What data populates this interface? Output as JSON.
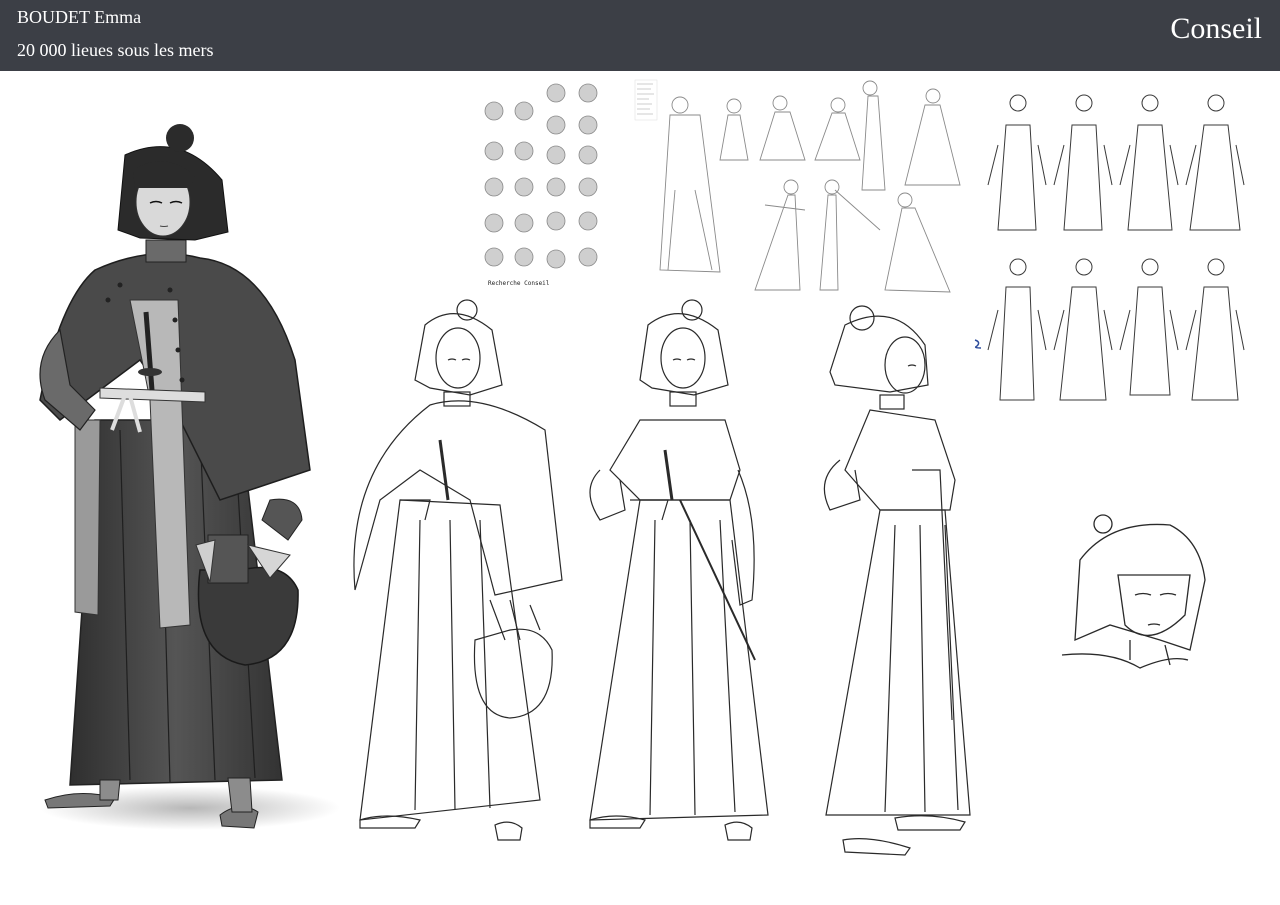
{
  "header": {
    "author": "BOUDET Emma",
    "project": "20 000 lieues sous les mers",
    "title": "Conseil"
  },
  "sheet": {
    "head_study_caption": "Recherche Conseil",
    "colors": {
      "header_bg": "#3c3f46",
      "header_text": "#ffffff",
      "line": "#2a2a2a",
      "shade_dark": "#3a3a3a",
      "shade_mid": "#6d6d6d",
      "paper": "#ffffff"
    }
  }
}
